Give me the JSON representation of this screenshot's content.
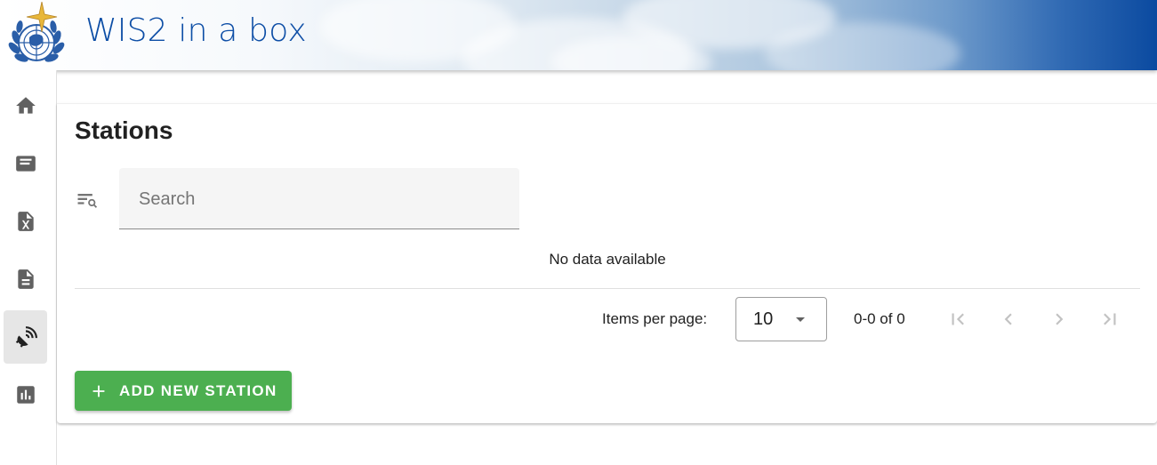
{
  "app": {
    "title": "WIS2 in a box",
    "logo_icon": "wmo-logo"
  },
  "sidebar": {
    "items": [
      {
        "name": "home",
        "icon": "home-icon",
        "active": false
      },
      {
        "name": "messages",
        "icon": "card-icon",
        "active": false
      },
      {
        "name": "csv",
        "icon": "excel-file-icon",
        "active": false
      },
      {
        "name": "documents",
        "icon": "document-icon",
        "active": false
      },
      {
        "name": "stations",
        "icon": "satellite-dish-icon",
        "active": true
      },
      {
        "name": "monitoring",
        "icon": "bar-chart-icon",
        "active": false
      }
    ]
  },
  "main": {
    "page_title": "Stations",
    "search": {
      "placeholder": "Search",
      "value": ""
    },
    "table": {
      "empty_text": "No data available"
    },
    "pagination": {
      "items_per_page_label": "Items per page:",
      "items_per_page": "10",
      "range_text": "0-0 of 0"
    },
    "add_button_label": "ADD NEW STATION"
  },
  "colors": {
    "brand_blue": "#0d4ea6",
    "add_button_green": "#4caf50",
    "active_nav_bg": "#e6e6e6"
  }
}
